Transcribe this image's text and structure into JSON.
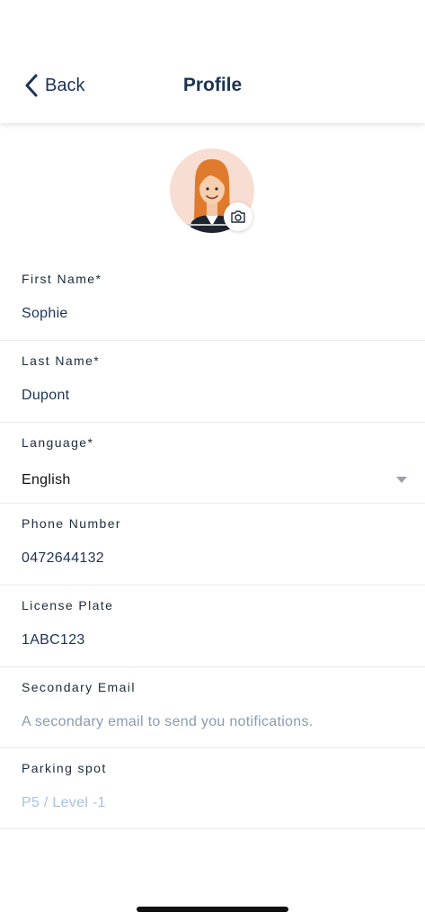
{
  "header": {
    "back_label": "Back",
    "title": "Profile"
  },
  "fields": {
    "first_name": {
      "label": "First Name*",
      "value": "Sophie"
    },
    "last_name": {
      "label": "Last Name*",
      "value": "Dupont"
    },
    "language": {
      "label": "Language*",
      "value": "English"
    },
    "phone": {
      "label": "Phone Number",
      "value": "0472644132"
    },
    "license_plate": {
      "label": "License Plate",
      "value": "1ABC123"
    },
    "secondary_email": {
      "label": "Secondary Email",
      "placeholder": "A secondary email to send you notifications."
    },
    "parking_spot": {
      "label": "Parking spot",
      "value": "P5 / Level -1"
    }
  },
  "colors": {
    "primary": "#1c3355",
    "placeholder": "#8a9bb0",
    "disabled": "#a9c1e3",
    "avatar_bg": "#f8ddd3"
  }
}
